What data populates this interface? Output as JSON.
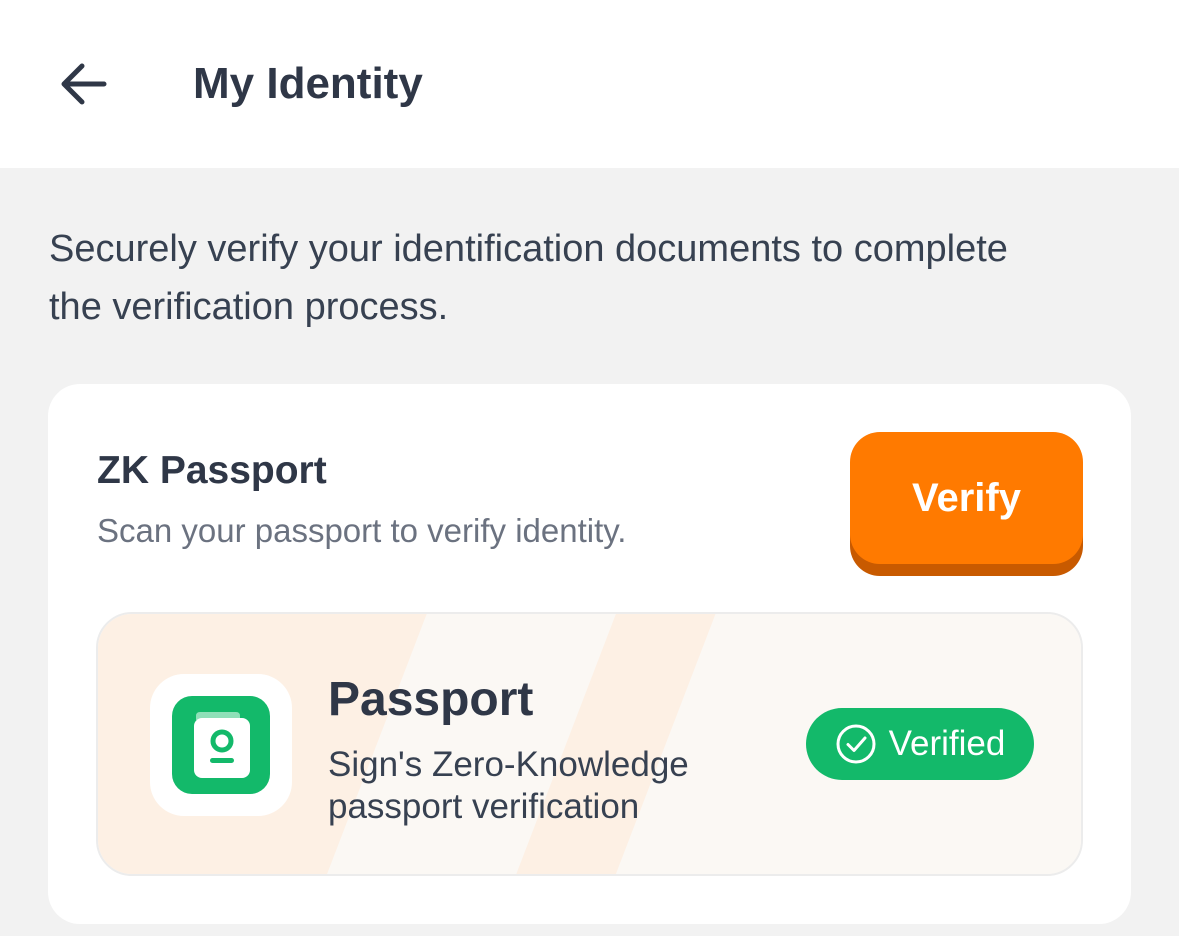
{
  "header": {
    "back_icon": "arrow-left-icon",
    "title": "My Identity"
  },
  "intro": {
    "text": "Securely verify your identification documents to complete the verification process."
  },
  "card": {
    "title": "ZK Passport",
    "subtitle": "Scan your passport to verify identity.",
    "verify_label": "Verify",
    "document": {
      "icon": "passport-icon",
      "title": "Passport",
      "description": "Sign's Zero-Knowledge passport verification",
      "status_icon": "check-circle-icon",
      "status": "Verified"
    }
  },
  "colors": {
    "accent": "#ff7a00",
    "accent_shadow": "#c85a00",
    "success": "#13b96a",
    "text_dark": "#2f3747",
    "background": "#f2f2f2"
  }
}
